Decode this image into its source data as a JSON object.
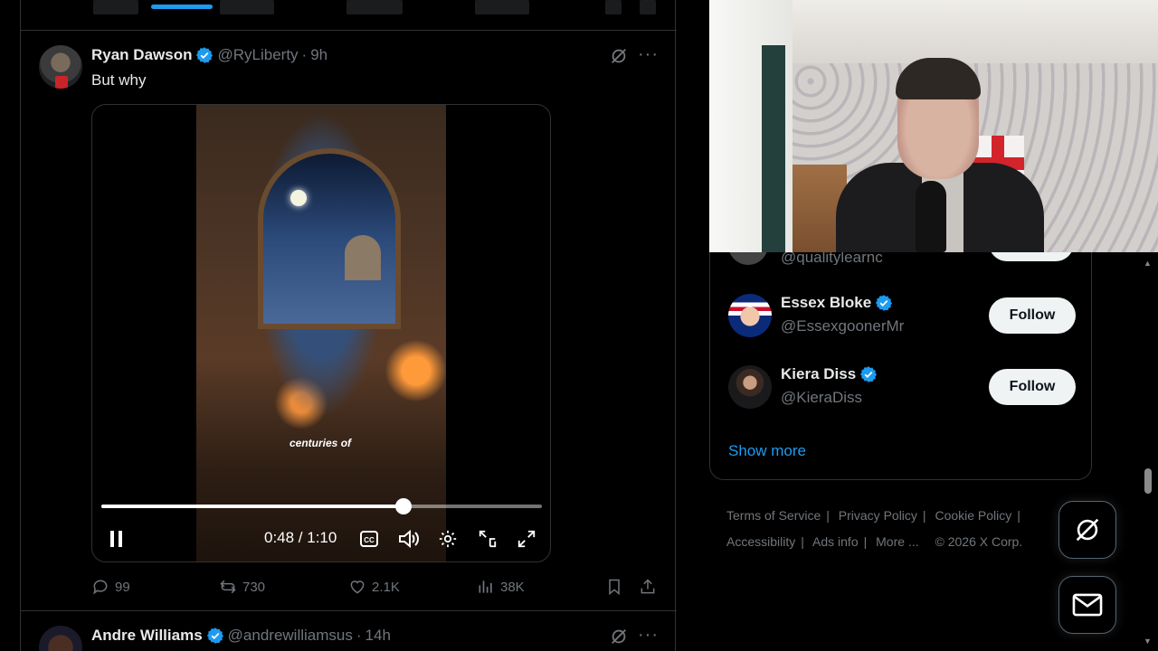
{
  "previous_tweet": {
    "stats_partial": [
      "",
      "",
      "",
      ""
    ]
  },
  "tweet": {
    "author_name": "Ryan Dawson",
    "handle": "@RyLiberty",
    "separator": "·",
    "time": "9h",
    "text": "But why",
    "more_label": "···",
    "video": {
      "caption": "centuries of",
      "current_time": "0:48",
      "duration": "1:10",
      "time_display": "0:48 / 1:10",
      "progress_fraction": 0.686
    },
    "actions": {
      "replies": "99",
      "reposts": "730",
      "likes": "2.1K",
      "views": "38K"
    }
  },
  "next_tweet": {
    "author_name": "Andre Williams",
    "handle": "@andrewilliamsus",
    "separator": "·",
    "time": "14h",
    "more_label": "···"
  },
  "who_to_follow": {
    "cut_off_handle": "@qualitylearnc",
    "accounts": [
      {
        "name": "Essex Bloke",
        "handle": "@EssexgoonerMr",
        "button": "Follow"
      },
      {
        "name": "Kiera Diss",
        "handle": "@KieraDiss",
        "button": "Follow"
      }
    ],
    "show_more": "Show more"
  },
  "footer": {
    "links": [
      "Terms of Service",
      "Privacy Policy",
      "Cookie Policy",
      "Accessibility",
      "Ads info",
      "More ..."
    ],
    "copyright": "© 2026 X Corp."
  },
  "colors": {
    "background": "#000000",
    "accent": "#1d9bf0",
    "muted_text": "#71767b",
    "border": "#2f3336",
    "follow_button_bg": "#eff3f4"
  },
  "icons": {
    "verified": "verified-badge-icon",
    "grok": "grok-icon",
    "reply": "reply-icon",
    "repost": "repost-icon",
    "like": "heart-icon",
    "views": "views-icon",
    "bookmark": "bookmark-icon",
    "share": "share-icon",
    "messages": "mail-icon"
  }
}
